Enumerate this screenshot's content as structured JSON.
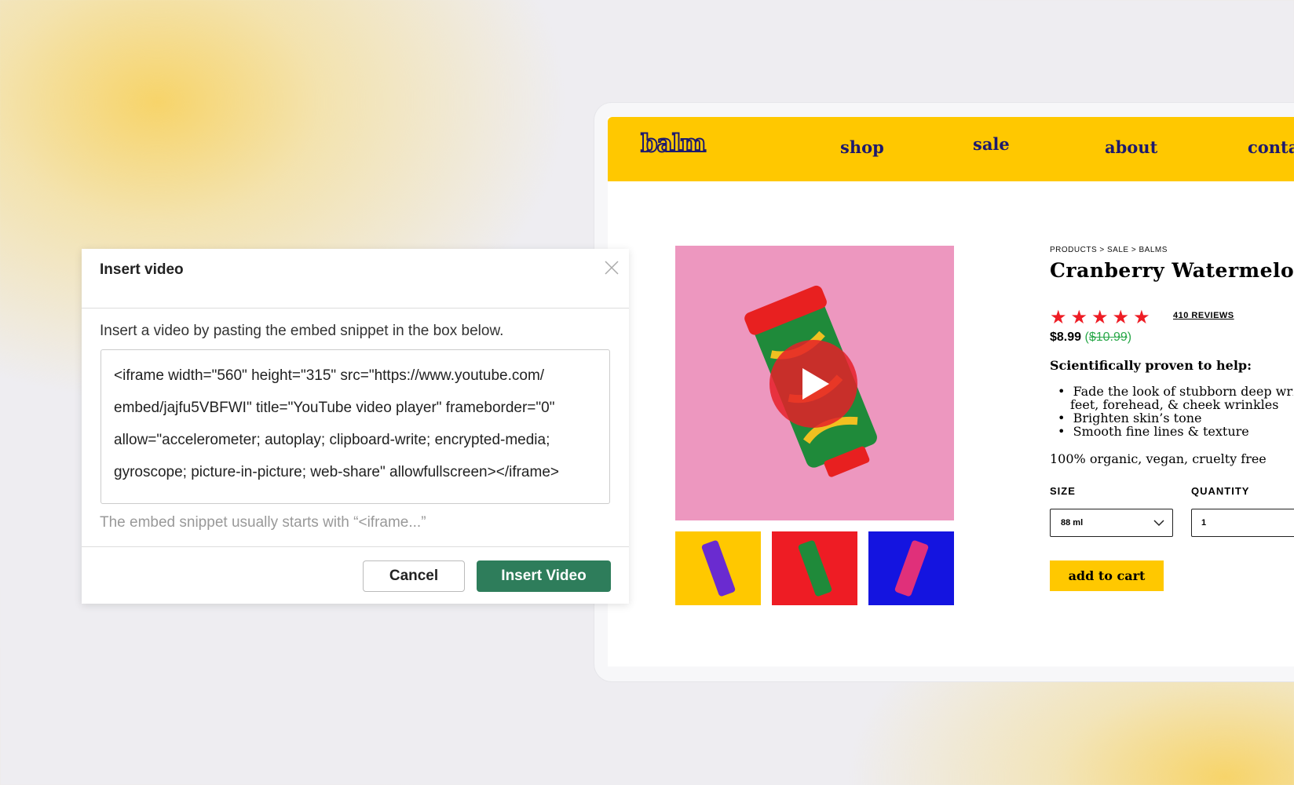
{
  "site": {
    "logo": "balm",
    "nav": [
      "shop",
      "sale",
      "about",
      "contact"
    ],
    "brand_color": "#ffc800",
    "nav_text_color": "#1d1a6e"
  },
  "product": {
    "breadcrumb": "PRODUCTS > SALE > BALMS",
    "title": "Cranberry Watermelon",
    "rating": 5,
    "reviews": "410 REVIEWS",
    "price": "$8.99",
    "old_price_open": "(",
    "old_price": "$10.99",
    "old_price_close": ")",
    "benefits_heading": "Scientifically proven to help:",
    "benefits": [
      "Fade the look of stubborn deep wrinkles, crow's feet, forehead, & cheek wrinkles",
      "Brighten skin’s tone",
      "Smooth fine lines & texture"
    ],
    "benefit_line1": "Fade the look of stubborn deep wrin",
    "benefit_line2": "feet, forehead, & cheek wrinkles",
    "claims": "100% organic, vegan, cruelty free",
    "size_label": "SIZE",
    "size_value": "88 ml",
    "quantity_label": "QUANTITY",
    "quantity_value": "1",
    "add_to_cart": "add to cart",
    "thumb_colors": [
      "#ffc800",
      "#ee1c24",
      "#1414e0"
    ],
    "hero_color": "#ed97bf"
  },
  "dialog": {
    "title": "Insert video",
    "instruction": "Insert a video by pasting the embed snippet in the box below.",
    "snippet_lines": [
      "<iframe width=\"560\" height=\"315\" src=\"https://www.youtube.com/",
      "embed/jajfu5VBFWI\" title=\"YouTube video player\" frameborder=\"0\"",
      "allow=\"accelerometer; autoplay; clipboard-write; encrypted-media;",
      "gyroscope; picture-in-picture; web-share\" allowfullscreen></iframe>"
    ],
    "helper": "The embed snippet usually starts with “<iframe...”",
    "cancel": "Cancel",
    "insert": "Insert Video",
    "primary_color": "#2e7d5b"
  }
}
